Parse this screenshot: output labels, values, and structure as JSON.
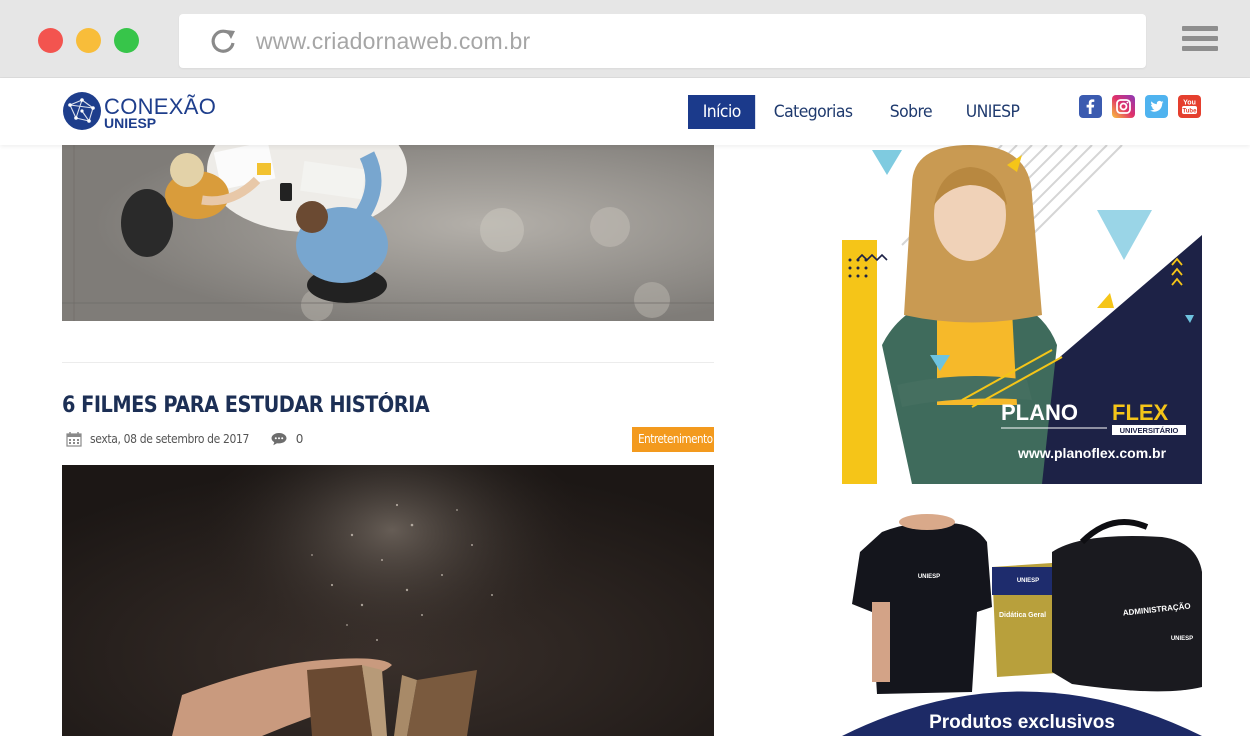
{
  "browser": {
    "url": "www.criadornaweb.com.br"
  },
  "header": {
    "logo": {
      "line1": "CONEXÃO",
      "line2": "UNIESP"
    },
    "nav": [
      {
        "label": "Início",
        "active": true
      },
      {
        "label": "Categorias",
        "active": false
      },
      {
        "label": "Sobre",
        "active": false
      },
      {
        "label": "UNIESP",
        "active": false
      }
    ],
    "social": [
      "facebook-icon",
      "instagram-icon",
      "twitter-icon",
      "youtube-icon"
    ]
  },
  "post": {
    "title": "6 FILMES PARA ESTUDAR HISTÓRIA",
    "date": "sexta, 08 de setembro de 2017",
    "comments": "0",
    "category": "Entretenimento"
  },
  "sidebar": {
    "ad1": {
      "brand_left": "PLANO",
      "brand_right": "FLEX",
      "brand_sub": "UNIVERSITÁRIO",
      "url": "www.planoflex.com.br"
    },
    "ad2": {
      "caption": "Produtos exclusivos",
      "shirt_text": "UNIESP",
      "book_brand": "UNIESP",
      "book_title": "Didática Geral",
      "bag_text": "ADMINISTRAÇÃO",
      "bag_brand": "UNIESP"
    }
  },
  "colors": {
    "nav_active": "#1b3a8b",
    "tag": "#f39a1e",
    "title": "#1c2f55",
    "ad_navy": "#1d2246",
    "ad_yellow": "#f5c518"
  }
}
